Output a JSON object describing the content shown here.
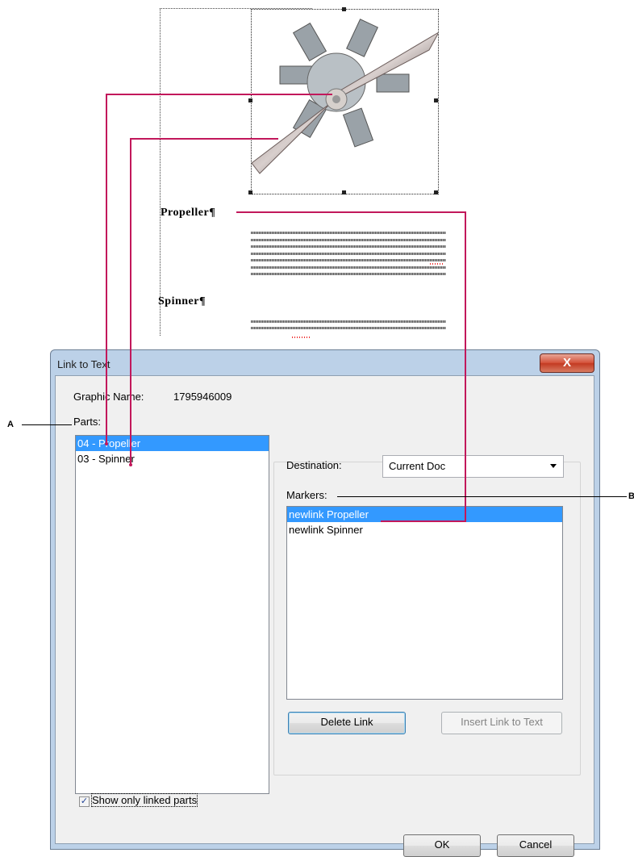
{
  "document": {
    "headings": [
      "Propeller¶",
      "Spinner¶"
    ]
  },
  "dialog": {
    "title": "Link to Text",
    "close_glyph": "X",
    "graphic_name_label": "Graphic Name:",
    "graphic_name_value": "1795946009",
    "parts_label": "Parts:",
    "parts": [
      {
        "label": "04 - Propeller",
        "selected": true
      },
      {
        "label": "03 - Spinner",
        "selected": false
      }
    ],
    "destination_label": "Destination:",
    "destination_value": "Current Doc",
    "markers_label": "Markers:",
    "markers": [
      {
        "label": "newlink Propeller",
        "selected": true
      },
      {
        "label": "newlink Spinner",
        "selected": false
      }
    ],
    "delete_link_label": "Delete Link",
    "insert_link_label": "Insert Link to Text",
    "show_only_linked_label": "Show only linked parts",
    "show_only_linked_checked": true,
    "checkbox_glyph": "✓",
    "ok_label": "OK",
    "cancel_label": "Cancel"
  },
  "callouts": {
    "a": "A",
    "b": "B"
  },
  "colors": {
    "link_lines": "#c2185b",
    "selection": "#3399ff",
    "dialog_frame": "#bcd1e8"
  }
}
